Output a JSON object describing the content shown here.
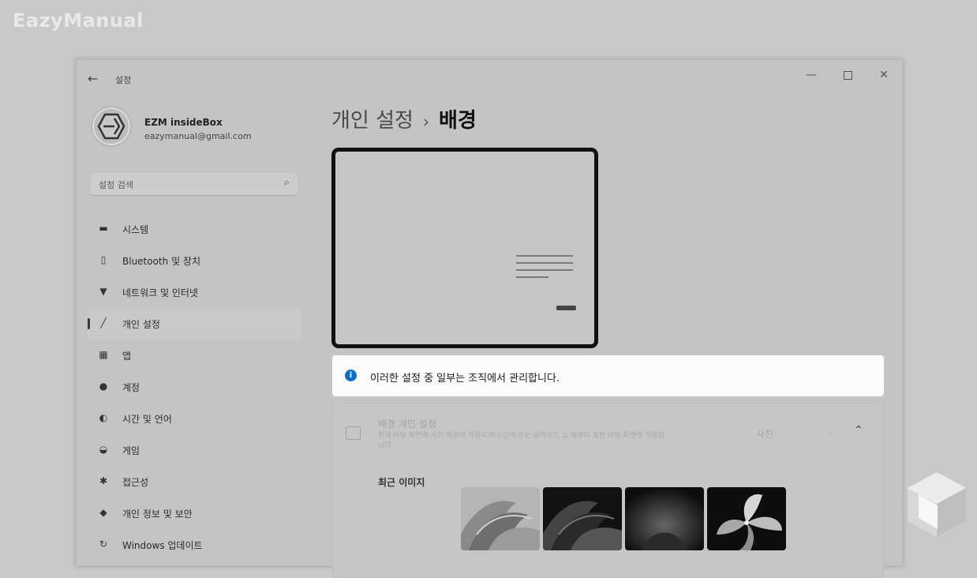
{
  "watermark": "EazyManual",
  "window": {
    "back_icon": "back-arrow-icon",
    "title": "설정",
    "controls": [
      "minimize-icon",
      "maximize-icon",
      "close-icon"
    ]
  },
  "profile": {
    "name": "EZM insideBox",
    "email": "eazymanual@gmail.com"
  },
  "search": {
    "placeholder": "설정 검색"
  },
  "sidebar": {
    "items": [
      {
        "label": "시스템",
        "icon": "display-icon",
        "selected": false
      },
      {
        "label": "Bluetooth 및 장치",
        "icon": "bluetooth-devices-icon",
        "selected": false
      },
      {
        "label": "네트워크 및 인터넷",
        "icon": "wifi-icon",
        "selected": false
      },
      {
        "label": "개인 설정",
        "icon": "pen-icon",
        "selected": true
      },
      {
        "label": "앱",
        "icon": "apps-icon",
        "selected": false
      },
      {
        "label": "계정",
        "icon": "person-icon",
        "selected": false
      },
      {
        "label": "시간 및 언어",
        "icon": "globe-clock-icon",
        "selected": false
      },
      {
        "label": "게임",
        "icon": "gamepad-icon",
        "selected": false
      },
      {
        "label": "접근성",
        "icon": "accessibility-icon",
        "selected": false
      },
      {
        "label": "개인 정보 및 보안",
        "icon": "shield-icon",
        "selected": false
      },
      {
        "label": "Windows 업데이트",
        "icon": "update-icon",
        "selected": false
      }
    ]
  },
  "breadcrumb": {
    "parent": "개인 설정",
    "separator": "›",
    "current": "배경"
  },
  "info_bar": {
    "icon": "info-icon",
    "text": "이러한 설정 중 일부는 조직에서 관리합니다."
  },
  "background_card": {
    "title": "배경 개인 설정",
    "description": "현재 바탕 화면에 사진 배경이 적용되거나 단색 또는 슬라이드 쇼 배경이 표현 바탕 화면에 적용됩니다",
    "dropdown_value": "사진",
    "recent_images_label": "최근 이미지"
  },
  "colors": {
    "accent": "#0b6fc2",
    "window_bg": "#c4c4c4",
    "info_bar_bg": "#fbfbfb"
  }
}
